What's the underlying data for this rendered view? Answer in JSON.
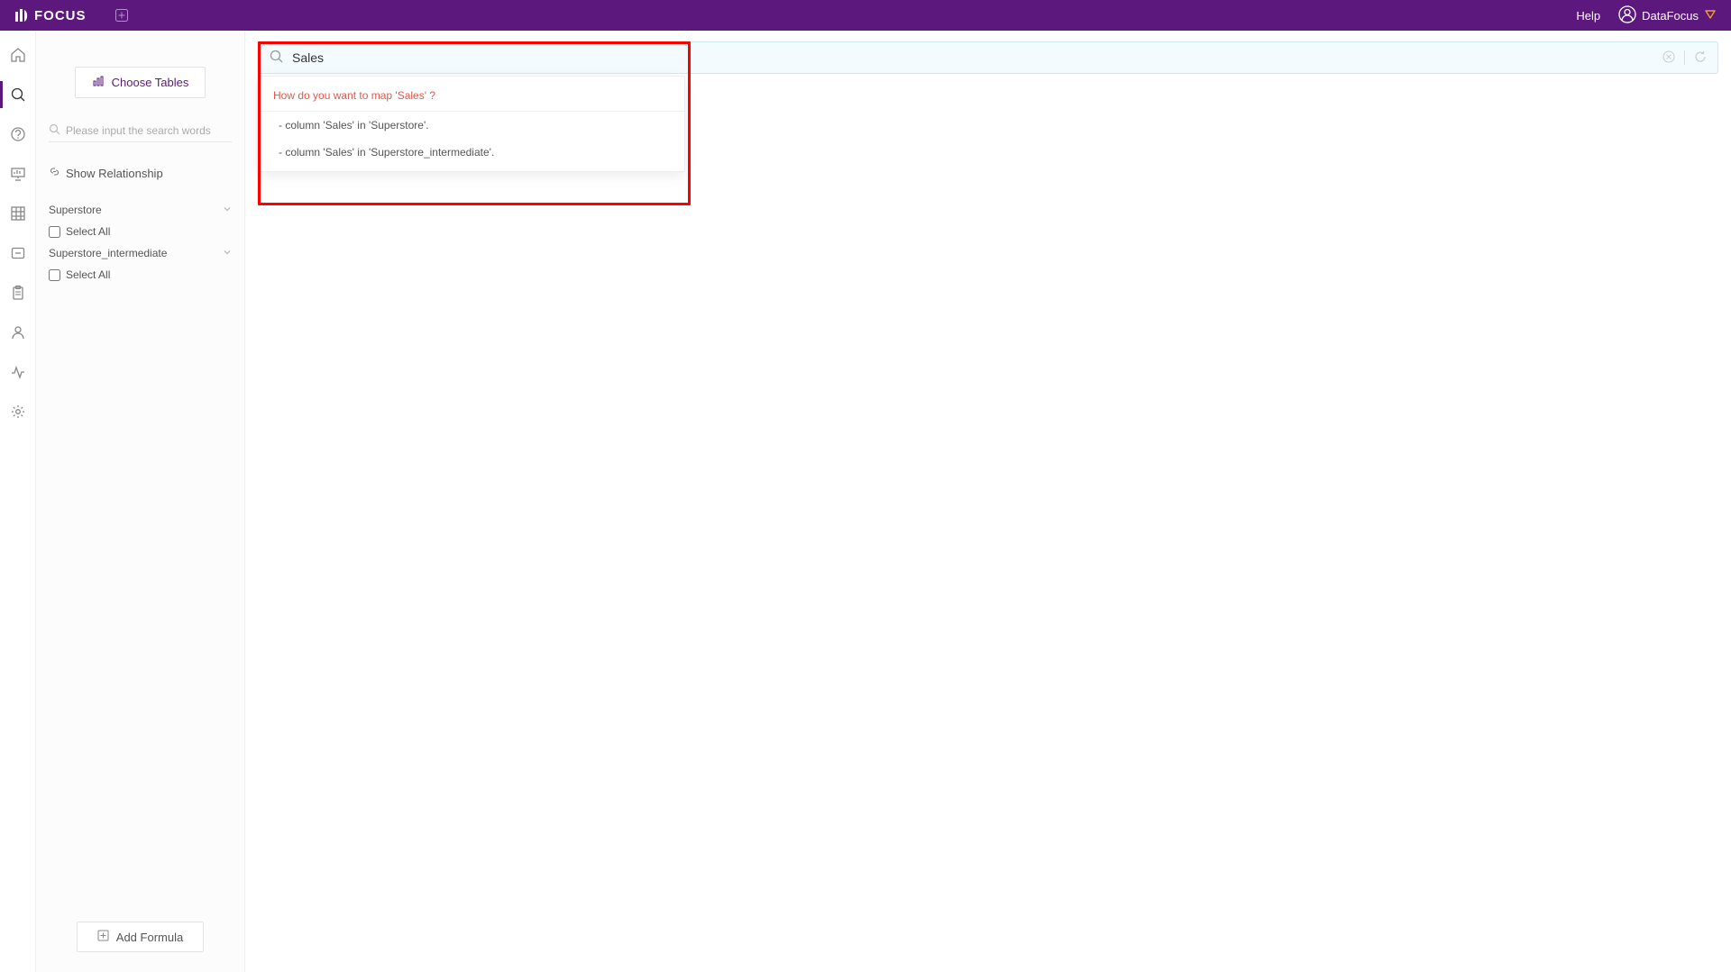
{
  "app": {
    "name": "FOCUS"
  },
  "header": {
    "help": "Help",
    "username": "DataFocus"
  },
  "sidepanel": {
    "choose_tables": "Choose Tables",
    "search_placeholder": "Please input the search words",
    "show_relationship": "Show Relationship",
    "tables": [
      {
        "name": "Superstore",
        "select_all": "Select All"
      },
      {
        "name": "Superstore_intermediate",
        "select_all": "Select All"
      }
    ],
    "add_formula": "Add Formula"
  },
  "search": {
    "value": "Sales"
  },
  "dropdown": {
    "prompt": "How do you want to map 'Sales' ?",
    "options": [
      "- column 'Sales' in 'Superstore'.",
      "- column 'Sales' in 'Superstore_intermediate'."
    ]
  }
}
